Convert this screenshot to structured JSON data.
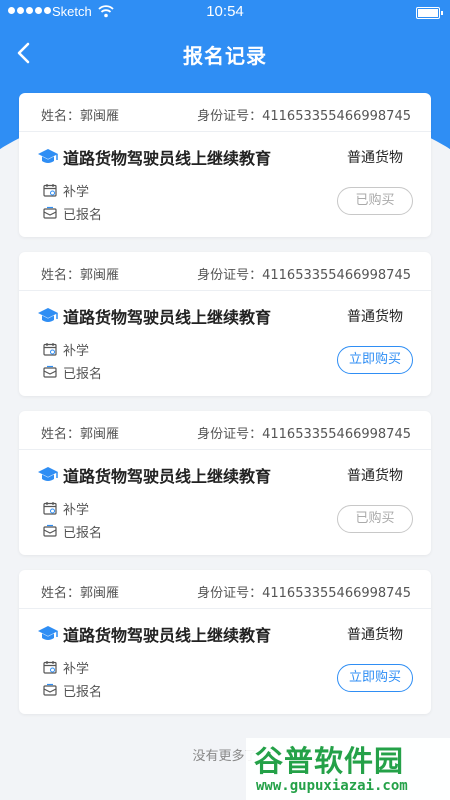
{
  "status_bar": {
    "carrier": "Sketch",
    "time": "10:54"
  },
  "nav": {
    "title": "报名记录"
  },
  "records": [
    {
      "name_label": "姓名：",
      "name": "郭闽雁",
      "id_label": "身份证号：",
      "id_number": "411653355466998745",
      "course": "道路货物驾驶员线上继续教育",
      "category": "普通货物",
      "type": "补学",
      "status": "已报名",
      "action": "已购买",
      "action_state": "purchased"
    },
    {
      "name_label": "姓名：",
      "name": "郭闽雁",
      "id_label": "身份证号：",
      "id_number": "411653355466998745",
      "course": "道路货物驾驶员线上继续教育",
      "category": "普通货物",
      "type": "补学",
      "status": "已报名",
      "action": "立即购买",
      "action_state": "buy"
    },
    {
      "name_label": "姓名：",
      "name": "郭闽雁",
      "id_label": "身份证号：",
      "id_number": "411653355466998745",
      "course": "道路货物驾驶员线上继续教育",
      "category": "普通货物",
      "type": "补学",
      "status": "已报名",
      "action": "已购买",
      "action_state": "purchased"
    },
    {
      "name_label": "姓名：",
      "name": "郭闽雁",
      "id_label": "身份证号：",
      "id_number": "411653355466998745",
      "course": "道路货物驾驶员线上继续教育",
      "category": "普通货物",
      "type": "补学",
      "status": "已报名",
      "action": "立即购买",
      "action_state": "buy"
    }
  ],
  "footer": {
    "note": "没有更多了"
  },
  "watermark": {
    "brand": "谷普软件园",
    "url": "www.gupuxiazai.com"
  },
  "colors": {
    "primary": "#2f8ef4",
    "background": "#f2f4f7",
    "watermark": "#24a148"
  },
  "icons": {
    "back": "chevron-left-icon",
    "course": "graduation-cap-icon",
    "type": "calendar-icon",
    "status": "envelope-icon"
  }
}
